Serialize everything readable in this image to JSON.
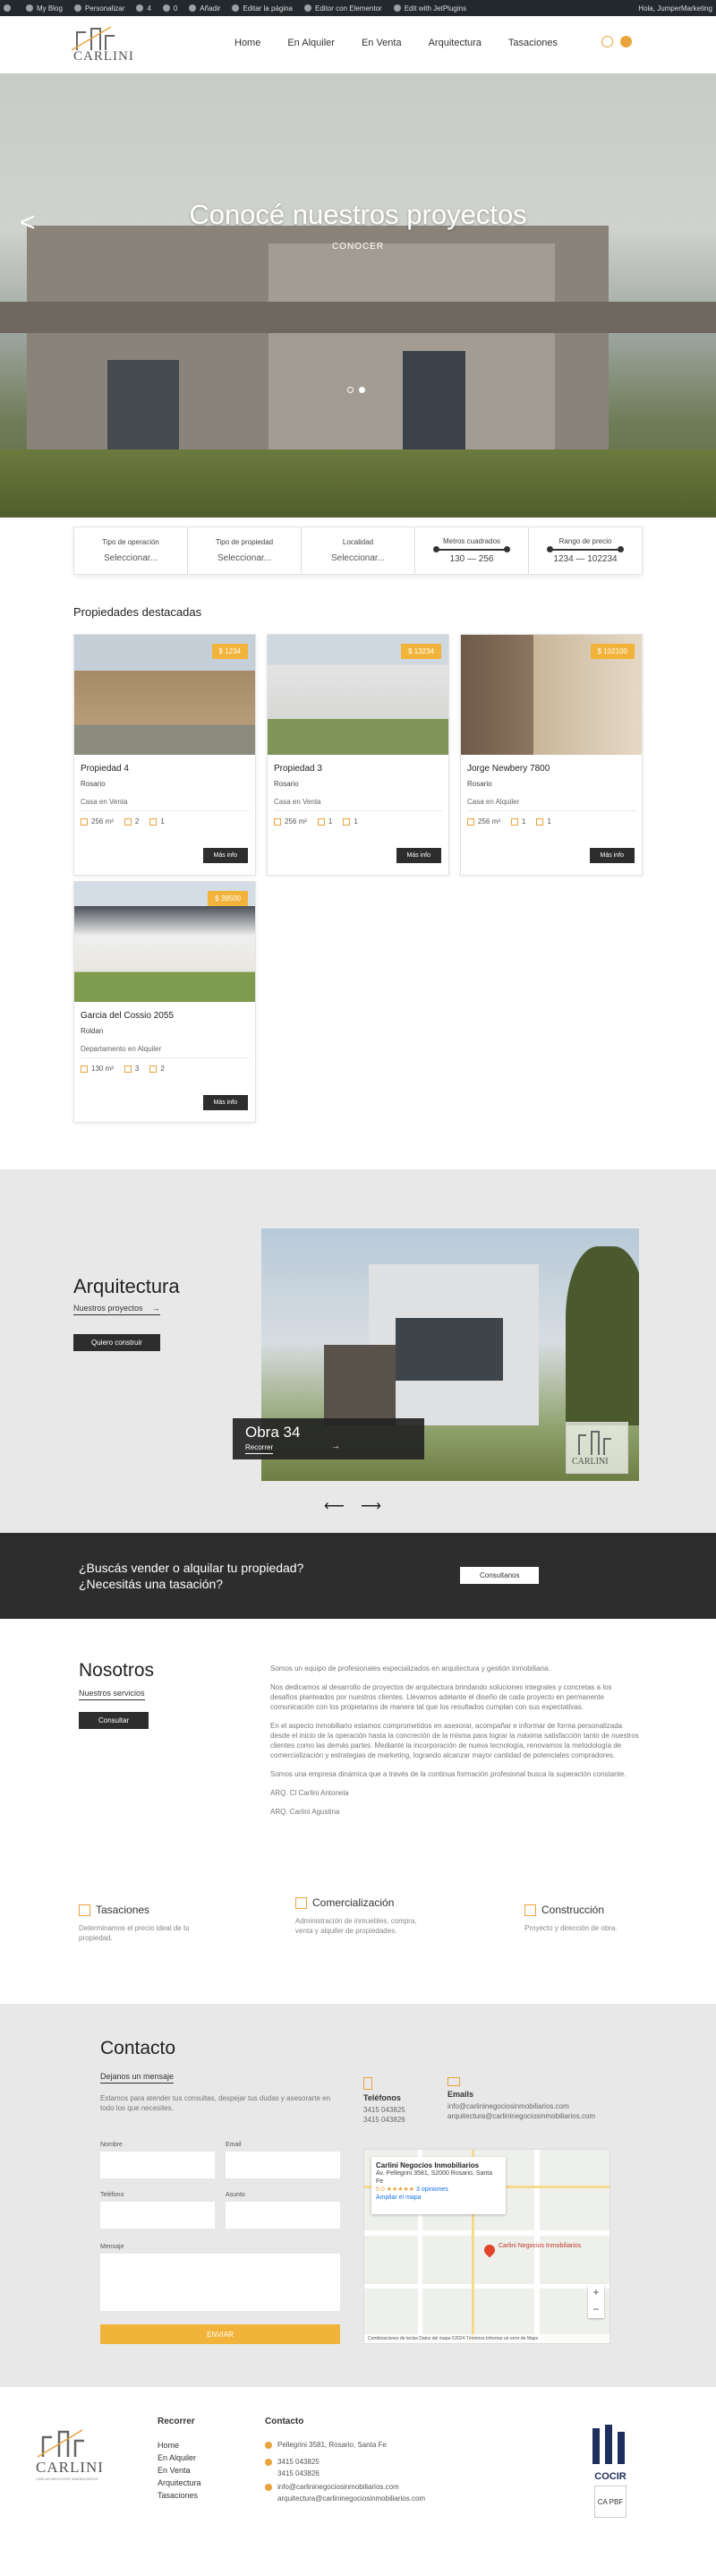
{
  "adminbar": {
    "items": [
      "My Blog",
      "Personalizar",
      "4",
      "0",
      "Añadir",
      "Editar la página",
      "Editor con Elementor",
      "Edit with JetPlugins"
    ],
    "greeting": "Hola, JumperMarketing"
  },
  "header": {
    "logo_text": "CARLINI",
    "nav": [
      "Home",
      "En Alquiler",
      "En Venta",
      "Arquitectura",
      "Tasaciones"
    ]
  },
  "hero": {
    "title": "Conocé nuestros proyectos",
    "button": "CONOCER",
    "prev_arrow": "<"
  },
  "search": {
    "fields": [
      {
        "label": "Tipo de operación",
        "value": "Seleccionar..."
      },
      {
        "label": "Tipo de propiedad",
        "value": "Seleccionar..."
      },
      {
        "label": "Localidad",
        "value": "Seleccionar..."
      }
    ],
    "m2": {
      "label": "Metros cuadrados",
      "value": "130 — 256"
    },
    "price": {
      "label": "Rango de precio",
      "value": "1234 — 102234"
    }
  },
  "featured": {
    "title": "Propiedades destacadas",
    "cards": [
      {
        "price": "$ 1234",
        "name": "Propiedad 4",
        "city": "Rosario",
        "type": "Casa en Venta",
        "m2": "256 m²",
        "rooms": "2",
        "baths": "1",
        "more": "Más info"
      },
      {
        "price": "$ 13234",
        "name": "Propiedad 3",
        "city": "Rosario",
        "type": "Casa en Venta",
        "m2": "256 m²",
        "rooms": "1",
        "baths": "1",
        "more": "Más info"
      },
      {
        "price": "$ 102100",
        "name": "Jorge Newbery 7800",
        "city": "Rosario",
        "type": "Casa en Alquiler",
        "m2": "256 m²",
        "rooms": "1",
        "baths": "1",
        "more": "Más info"
      },
      {
        "price": "$ 39500",
        "name": "Garcia del Cossio 2055",
        "city": "Roldan",
        "type": "Departamento en Alquiler",
        "m2": "130 m²",
        "rooms": "3",
        "baths": "2",
        "more": "Más info"
      }
    ]
  },
  "arquitectura": {
    "title": "Arquitectura",
    "subtitle": "Nuestros proyectos",
    "button": "Quiero construir",
    "slide_title": "Obra 34",
    "slide_link": "Recorrer",
    "watermark": "CARLINI",
    "prev": "⟵",
    "next": "⟶"
  },
  "cta": {
    "question_line1": "¿Buscás vender o alquilar tu propiedad?",
    "question_line2": "¿Necesitás una tasación?",
    "button": "Consultanos"
  },
  "nosotros": {
    "title": "Nosotros",
    "subtitle": "Nuestros servicios",
    "button": "Consultar",
    "paragraphs": [
      "Somos un equipo de profesionales especializados en arquitectura y gestión inmobiliaria.",
      "Nos dedicamos al desarrollo de proyectos de arquitectura brindando soluciones integrales y concretas a los desafíos planteados por nuestros clientes. Llevamos adelante el diseño de cada proyecto en permanente comunicación con los propietarios de manera tal que los resultados cumplan con sus expectativas.",
      "En el aspecto inmobiliario estamos comprometidos en asesorar, acompañar e informar de forma personalizada desde el inicio de la operación hasta la concreción de la misma para lograr la máxima satisfacción tanto de nuestros clientes como las demás partes. Mediante la incorporación de nueva tecnología, renovamos la metodología de comercialización y estrategias de marketing, logrando alcanzar mayor cantidad de potenciales compradores.",
      "Somos una empresa dinámica que a través de la continua formación profesional busca la superación constante.",
      "ARQ. Cl Carlini Antonela",
      "ARQ. Carlini Agustina"
    ],
    "services": [
      {
        "title": "Tasaciones",
        "desc": "Determinamos el precio ideal de tu propiedad."
      },
      {
        "title": "Comercialización",
        "desc": "Administración de inmuebles, compra, venta y alquiler de propiedades."
      },
      {
        "title": "Construcción",
        "desc": "Proyecto y dirección de obra."
      }
    ]
  },
  "contacto": {
    "title": "Contacto",
    "subtitle": "Dejanos un mensaje",
    "desc": "Estamos para atender tus consultas, despejar tus dudas y asesorarte en todo los que necesites.",
    "labels": {
      "nombre": "Nombre",
      "email": "Email",
      "telefono": "Teléfono",
      "asunto": "Asunto",
      "mensaje": "Mensaje"
    },
    "send": "ENVIAR",
    "phones_title": "Teléfonos",
    "phones": [
      "3415 043825",
      "3415 043826"
    ],
    "emails_title": "Emails",
    "emails": [
      "info@carlininegociosinmobiliarios.com",
      "arquitectura@carlininegociosinmobiliarios.com"
    ],
    "map": {
      "place": "Carlini Negocios Inmobiliarios",
      "address": "Av. Pellegrini 3581, S2000 Rosario, Santa Fe",
      "rating": "5.0 ★★★★★",
      "reviews": "3 opiniones",
      "enlarge": "Ampliar el mapa",
      "pin_label": "Carlini Negocios Inmobiliarios",
      "footer": "Combinaciones de teclas   Datos del mapa ©2024   Términos   Informar un error de Maps"
    }
  },
  "footer": {
    "logo_text": "CARLINI",
    "logo_sub": "CARLINI NEGOCIOS INMOBILIARIOS",
    "nav_title": "Recorrer",
    "nav": [
      "Home",
      "En Alquiler",
      "En Venta",
      "Arquitectura",
      "Tasaciones"
    ],
    "contact_title": "Contacto",
    "address": "Pellegrini 3581, Rosario, Santa Fe",
    "phones": [
      "3415 043825",
      "3415 043826"
    ],
    "emails": [
      "info@carlininegociosinmobiliarios.com",
      "arquitectura@carlininegociosinmobiliarios.com"
    ],
    "badge_text": "COCIR",
    "badge_sub": "CA PBF"
  },
  "colors": {
    "accent": "#f2b33a",
    "dark": "#2d2d2d",
    "band": "#e8e8e8"
  }
}
